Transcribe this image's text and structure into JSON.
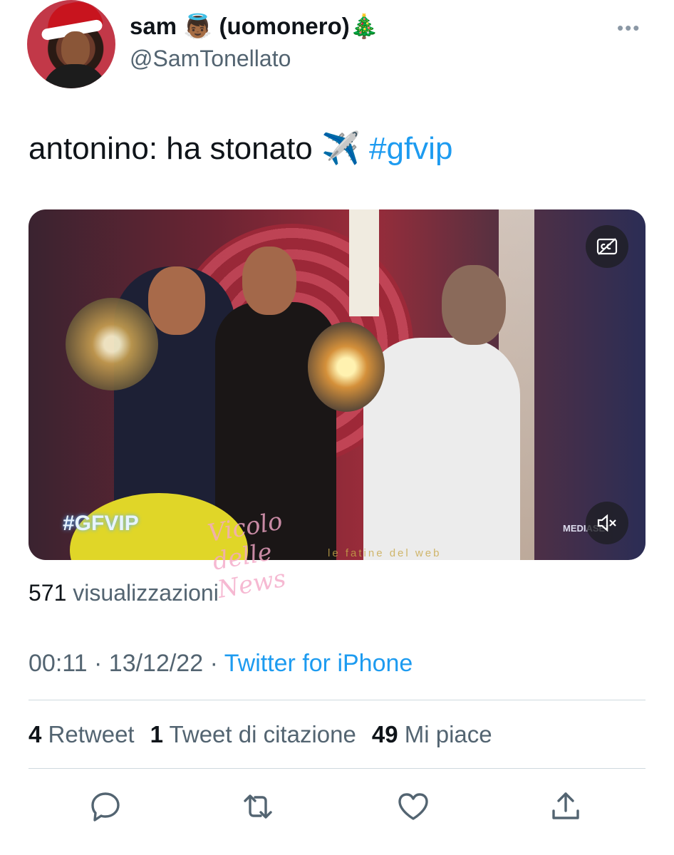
{
  "author": {
    "display_name": "sam 👼🏾 (uomonero)🎄",
    "handle": "@SamTonellato"
  },
  "more_icon": "more-dots-icon",
  "tweet": {
    "text_prefix": "antonino: ha stonato ✈️ ",
    "hashtag": "#gfvip"
  },
  "media": {
    "overlay_logo": "#GFVIP",
    "channel_logo": "MEDIASET",
    "watermark": "Vicolo delle News",
    "watermark2": "le fatine del web",
    "cc_icon": "closed-captions-icon",
    "mute_icon": "mute-icon"
  },
  "views": {
    "count": "571",
    "label": "visualizzazioni"
  },
  "meta": {
    "time": "00:11",
    "sep1": " · ",
    "date": "13/12/22",
    "sep2": " · ",
    "source": "Twitter for iPhone"
  },
  "stats": {
    "retweets_count": "4",
    "retweets_label": "Retweet",
    "quotes_count": "1",
    "quotes_label": "Tweet di citazione",
    "likes_count": "49",
    "likes_label": "Mi piace"
  },
  "actions": [
    "reply-icon",
    "retweet-icon",
    "like-icon",
    "share-icon"
  ]
}
